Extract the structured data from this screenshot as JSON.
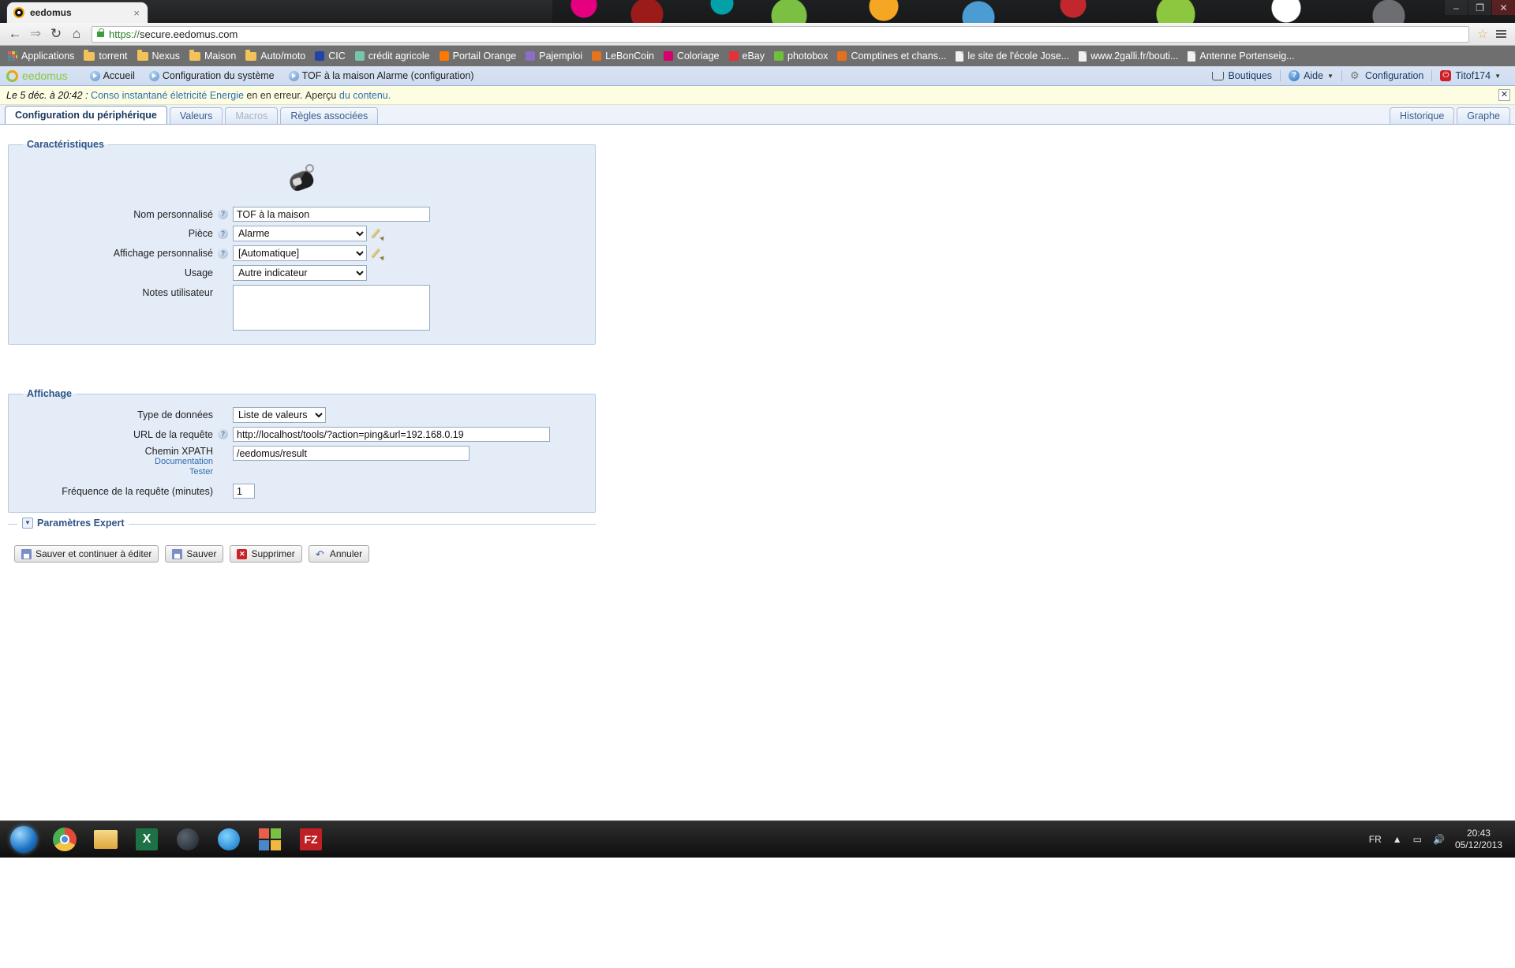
{
  "browser": {
    "tab": {
      "title": "eedomus",
      "favicon": "eedomus-logo-icon",
      "close": "×"
    },
    "window_controls": {
      "minimize": "–",
      "maximize": "❐",
      "close": "✕"
    },
    "toolbar": {
      "back": "←",
      "forward": "⇒",
      "reload": "↻",
      "home": "⌂",
      "url_scheme": "https://",
      "url_rest": "secure.eedomus.com",
      "star": "☆",
      "menu": "menu"
    },
    "bookmarks": [
      {
        "label": "Applications",
        "icon": "apps-grid-icon",
        "type": "apps"
      },
      {
        "label": "torrent",
        "icon": "folder-icon",
        "type": "folder"
      },
      {
        "label": "Nexus",
        "icon": "folder-icon",
        "type": "folder"
      },
      {
        "label": "Maison",
        "icon": "folder-icon",
        "type": "folder"
      },
      {
        "label": "Auto/moto",
        "icon": "folder-icon",
        "type": "folder"
      },
      {
        "label": "CIC",
        "icon": "cic-favicon",
        "type": "sq",
        "color": "#2244aa"
      },
      {
        "label": "crédit agricole",
        "icon": "credit-agricole-favicon",
        "type": "sq",
        "color": "#77c5ad"
      },
      {
        "label": "Portail Orange",
        "icon": "orange-favicon",
        "type": "sq",
        "color": "#ff7900"
      },
      {
        "label": "Pajemploi",
        "icon": "pajemploi-favicon",
        "type": "sq",
        "color": "#8a6fc4"
      },
      {
        "label": "LeBonCoin",
        "icon": "leboncoin-favicon",
        "type": "sq",
        "color": "#e8731b"
      },
      {
        "label": "Coloriage",
        "icon": "coloriage-favicon",
        "type": "sq",
        "color": "#d6006e"
      },
      {
        "label": "eBay",
        "icon": "ebay-favicon",
        "type": "sq",
        "color": "#e53238"
      },
      {
        "label": "photobox",
        "icon": "photobox-favicon",
        "type": "sq",
        "color": "#6fbf3b"
      },
      {
        "label": "Comptines et chans...",
        "icon": "comptines-favicon",
        "type": "sq",
        "color": "#e86f1b"
      },
      {
        "label": "le site de l'école Jose...",
        "icon": "page-icon",
        "type": "doc"
      },
      {
        "label": "www.2galli.fr/bouti...",
        "icon": "page-icon",
        "type": "doc"
      },
      {
        "label": "Antenne Portenseig...",
        "icon": "page-icon",
        "type": "doc"
      }
    ]
  },
  "app": {
    "logo_text": "eedomus",
    "nav": [
      {
        "label": "Accueil"
      },
      {
        "label": "Configuration du système"
      },
      {
        "label": "TOF à la maison Alarme (configuration)"
      }
    ],
    "header_right": [
      {
        "label": "Boutiques",
        "icon": "cart-icon",
        "caret": false
      },
      {
        "label": "Aide",
        "icon": "help-circle-icon",
        "caret": true
      },
      {
        "label": "Configuration",
        "icon": "gear-icon",
        "caret": false
      },
      {
        "label": "Titof174",
        "icon": "power-icon",
        "caret": true
      }
    ],
    "notice": {
      "stamp": "Le 5 déc. à 20:42 :",
      "link1": "Conso instantané életricité Energie",
      "mid": "en en erreur.",
      "text2": "Aperçu",
      "link2": "du contenu.",
      "close": "✕"
    },
    "tabs": [
      {
        "label": "Configuration du périphérique",
        "state": "active"
      },
      {
        "label": "Valeurs",
        "state": "normal"
      },
      {
        "label": "Macros",
        "state": "disabled"
      },
      {
        "label": "Règles associées",
        "state": "normal"
      }
    ],
    "tabs_right": [
      {
        "label": "Historique"
      },
      {
        "label": "Graphe"
      }
    ]
  },
  "form": {
    "caracteristiques": {
      "legend": "Caractéristiques",
      "device_icon": "key-fob-icon",
      "fields": {
        "nom_label": "Nom personnalisé",
        "nom_value": "TOF à la maison",
        "piece_label": "Pièce",
        "piece_value": "Alarme",
        "affichage_label": "Affichage personnalisé",
        "affichage_value": "[Automatique]",
        "usage_label": "Usage",
        "usage_value": "Autre indicateur",
        "notes_label": "Notes utilisateur",
        "notes_value": ""
      }
    },
    "affichage": {
      "legend": "Affichage",
      "fields": {
        "type_label": "Type de données",
        "type_value": "Liste de valeurs",
        "url_label": "URL de la requête",
        "url_value": "http://localhost/tools/?action=ping&url=192.168.0.19",
        "xpath_label": "Chemin XPATH",
        "xpath_value": "/eedomus/result",
        "doc_link": "Documentation",
        "test_link": "Tester",
        "freq_label": "Fréquence de la requête (minutes)",
        "freq_value": "1"
      }
    },
    "expert": {
      "title": "Paramètres Expert",
      "twisty": "▼"
    },
    "buttons": [
      {
        "label": "Sauver et continuer à éditer",
        "icon": "save-icon"
      },
      {
        "label": "Sauver",
        "icon": "save-icon"
      },
      {
        "label": "Supprimer",
        "icon": "delete-icon"
      },
      {
        "label": "Annuler",
        "icon": "undo-icon"
      }
    ]
  },
  "taskbar": {
    "items": [
      {
        "name": "start-orb",
        "label": ""
      },
      {
        "name": "chrome",
        "label": ""
      },
      {
        "name": "explorer",
        "label": ""
      },
      {
        "name": "excel",
        "label": "X"
      },
      {
        "name": "steam",
        "label": ""
      },
      {
        "name": "app-blue",
        "label": ""
      },
      {
        "name": "microsoft",
        "label": ""
      },
      {
        "name": "filezilla",
        "label": "FZ"
      }
    ],
    "tray": {
      "language": "FR",
      "show_hidden": "▲",
      "network": "▭",
      "volume": "🔊",
      "time": "20:43",
      "date": "05/12/2013"
    }
  }
}
